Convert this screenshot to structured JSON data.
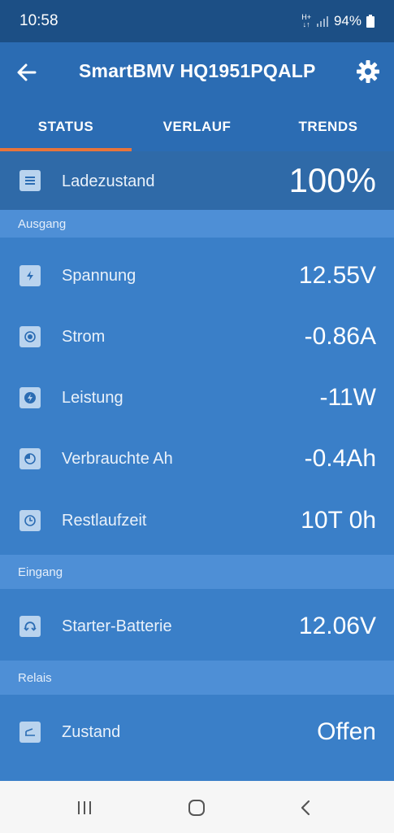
{
  "statusbar": {
    "time": "10:58",
    "net_type": "H+",
    "battery": "94%"
  },
  "appbar": {
    "title": "SmartBMV HQ1951PQALP"
  },
  "tabs": [
    {
      "label": "STATUS"
    },
    {
      "label": "VERLAUF"
    },
    {
      "label": "TRENDS"
    }
  ],
  "active_tab": "STATUS",
  "colors": {
    "accent": "#e8743b",
    "primary": "#2b6cb3",
    "background": "#3a7fc8"
  },
  "soc": {
    "label": "Ladezustand",
    "value": "100%",
    "icon": "list-icon"
  },
  "sections": {
    "ausgang": {
      "title": "Ausgang",
      "rows": [
        {
          "label": "Spannung",
          "value": "12.55V",
          "icon": "voltage-icon"
        },
        {
          "label": "Strom",
          "value": "-0.86A",
          "icon": "current-icon"
        },
        {
          "label": "Leistung",
          "value": "-11W",
          "icon": "power-icon"
        },
        {
          "label": "Verbrauchte Ah",
          "value": "-0.4Ah",
          "icon": "consumed-icon"
        },
        {
          "label": "Restlaufzeit",
          "value": "10T 0h",
          "icon": "clock-icon"
        }
      ]
    },
    "eingang": {
      "title": "Eingang",
      "rows": [
        {
          "label": "Starter-Batterie",
          "value": "12.06V",
          "icon": "battery-cycle-icon"
        }
      ]
    },
    "relais": {
      "title": "Relais",
      "rows": [
        {
          "label": "Zustand",
          "value": "Offen",
          "icon": "relay-icon"
        }
      ]
    }
  },
  "navbar": {
    "recents": "recents-icon",
    "home": "home-icon",
    "back": "back-icon"
  }
}
